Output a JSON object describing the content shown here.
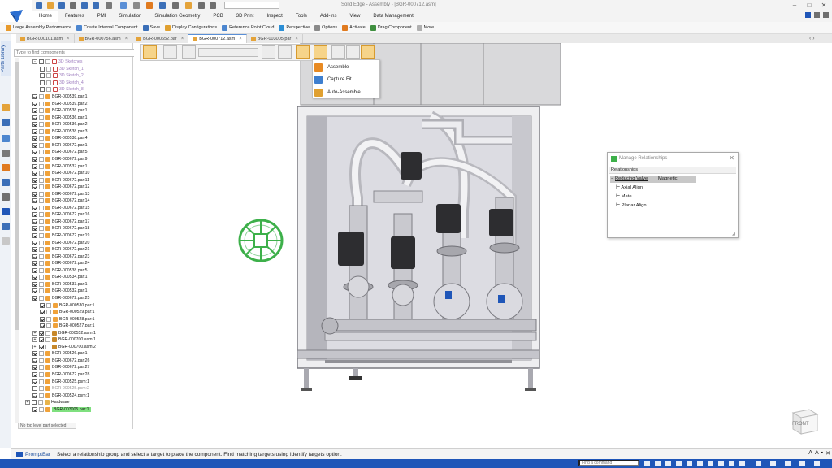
{
  "window": {
    "title": "Solid Edge - Assembly - [BGR-000712.asm]"
  },
  "ribbon_tabs": [
    "Home",
    "Features",
    "PMI",
    "Simulation",
    "Simulation Geometry",
    "PCB",
    "3D Print",
    "Inspect",
    "Tools",
    "Add-Ins",
    "View",
    "Data Management"
  ],
  "command_bar": [
    {
      "label": "Large Assembly Performance",
      "color": "#e89a2c"
    },
    {
      "label": "Create Internal Component",
      "color": "#4c86cf"
    },
    {
      "label": "Save",
      "color": "#3b6fb8"
    },
    {
      "label": "Display Configurations",
      "color": "#e0a030"
    },
    {
      "label": "Reference Point Cloud",
      "color": "#4c86cf"
    },
    {
      "label": "Perspective",
      "color": "#2c8fd6"
    },
    {
      "label": "Options",
      "color": "#8a8a8a"
    },
    {
      "label": "Activate",
      "color": "#e07a1f"
    },
    {
      "label": "Drag Component",
      "color": "#3f8f3f"
    },
    {
      "label": "More",
      "color": "#b0b0b0"
    }
  ],
  "doc_tabs": [
    {
      "label": "BGR-000101.asm",
      "active": false
    },
    {
      "label": "BGR-000756.asm",
      "active": false
    },
    {
      "label": "BGR-000652.par",
      "active": false
    },
    {
      "label": "BGR-000712.asm",
      "active": true
    },
    {
      "label": "BGR-003005.par",
      "active": false
    }
  ],
  "sidebar": {
    "parts_library": "Parts Library"
  },
  "pathfinder": {
    "search_placeholder": "Type to find components",
    "status": "No top level part selected",
    "items": [
      {
        "label": "3D Sketches",
        "type": "sketch",
        "indent": 1,
        "checked": false,
        "expand": "-"
      },
      {
        "label": "3D Sketch_1",
        "type": "sketch",
        "indent": 2,
        "checked": false
      },
      {
        "label": "3D Sketch_2",
        "type": "sketch",
        "indent": 2,
        "checked": false
      },
      {
        "label": "3D Sketch_4",
        "type": "sketch",
        "indent": 2,
        "checked": false
      },
      {
        "label": "3D Sketch_8",
        "type": "sketch",
        "indent": 2,
        "checked": false
      },
      {
        "label": "BGR-000539.par:1",
        "type": "part",
        "indent": 1,
        "checked": true
      },
      {
        "label": "BGR-000539.par:2",
        "type": "part",
        "indent": 1,
        "checked": true
      },
      {
        "label": "BGR-000538.par:1",
        "type": "part",
        "indent": 1,
        "checked": true
      },
      {
        "label": "BGR-000536.par:1",
        "type": "part",
        "indent": 1,
        "checked": true
      },
      {
        "label": "BGR-000536.par:2",
        "type": "part",
        "indent": 1,
        "checked": true
      },
      {
        "label": "BGR-000538.par:3",
        "type": "part",
        "indent": 1,
        "checked": true
      },
      {
        "label": "BGR-000538.par:4",
        "type": "part",
        "indent": 1,
        "checked": true
      },
      {
        "label": "BGR-000672.par:1",
        "type": "part",
        "indent": 1,
        "checked": true
      },
      {
        "label": "BGR-000672.par:5",
        "type": "part",
        "indent": 1,
        "checked": true
      },
      {
        "label": "BGR-000672.par:9",
        "type": "part",
        "indent": 1,
        "checked": true
      },
      {
        "label": "BGR-000537.par:1",
        "type": "part",
        "indent": 1,
        "checked": true
      },
      {
        "label": "BGR-000672.par:10",
        "type": "part",
        "indent": 1,
        "checked": true
      },
      {
        "label": "BGR-000672.par:11",
        "type": "part",
        "indent": 1,
        "checked": true
      },
      {
        "label": "BGR-000672.par:12",
        "type": "part",
        "indent": 1,
        "checked": true
      },
      {
        "label": "BGR-000672.par:13",
        "type": "part",
        "indent": 1,
        "checked": true
      },
      {
        "label": "BGR-000672.par:14",
        "type": "part",
        "indent": 1,
        "checked": true
      },
      {
        "label": "BGR-000672.par:15",
        "type": "part",
        "indent": 1,
        "checked": true
      },
      {
        "label": "BGR-000672.par:16",
        "type": "part",
        "indent": 1,
        "checked": true
      },
      {
        "label": "BGR-000672.par:17",
        "type": "part",
        "indent": 1,
        "checked": true
      },
      {
        "label": "BGR-000672.par:18",
        "type": "part",
        "indent": 1,
        "checked": true
      },
      {
        "label": "BGR-000672.par:19",
        "type": "part",
        "indent": 1,
        "checked": true
      },
      {
        "label": "BGR-000672.par:20",
        "type": "part",
        "indent": 1,
        "checked": true
      },
      {
        "label": "BGR-000672.par:21",
        "type": "part",
        "indent": 1,
        "checked": true
      },
      {
        "label": "BGR-000672.par:23",
        "type": "part",
        "indent": 1,
        "checked": true
      },
      {
        "label": "BGR-000672.par:24",
        "type": "part",
        "indent": 1,
        "checked": true
      },
      {
        "label": "BGR-000538.par:5",
        "type": "part",
        "indent": 1,
        "checked": true
      },
      {
        "label": "BGR-000534.par:1",
        "type": "part",
        "indent": 1,
        "checked": true
      },
      {
        "label": "BGR-000533.par:1",
        "type": "part",
        "indent": 1,
        "checked": true
      },
      {
        "label": "BGR-000532.par:1",
        "type": "part",
        "indent": 1,
        "checked": true
      },
      {
        "label": "BGR-000672.par:25",
        "type": "part",
        "indent": 1,
        "checked": true
      },
      {
        "label": "BGR-000530.par:1",
        "type": "part",
        "indent": 2,
        "checked": true
      },
      {
        "label": "BGR-000529.par:1",
        "type": "part",
        "indent": 2,
        "checked": true
      },
      {
        "label": "BGR-000528.par:1",
        "type": "part",
        "indent": 2,
        "checked": true
      },
      {
        "label": "BGR-000527.par:1",
        "type": "part",
        "indent": 2,
        "checked": true
      },
      {
        "label": "BGR-000552.asm:1",
        "type": "asm",
        "indent": 1,
        "checked": true,
        "expand": "+"
      },
      {
        "label": "BGR-000700.asm:1",
        "type": "asm",
        "indent": 1,
        "checked": true,
        "expand": "+"
      },
      {
        "label": "BGR-000700.asm:2",
        "type": "asm",
        "indent": 1,
        "checked": true,
        "expand": "+"
      },
      {
        "label": "BGR-000526.par:1",
        "type": "part",
        "indent": 1,
        "checked": true
      },
      {
        "label": "BGR-000672.par:26",
        "type": "part",
        "indent": 1,
        "checked": true
      },
      {
        "label": "BGR-000672.par:27",
        "type": "part",
        "indent": 1,
        "checked": true
      },
      {
        "label": "BGR-000672.par:28",
        "type": "part",
        "indent": 1,
        "checked": true
      },
      {
        "label": "BGR-000525.psm:1",
        "type": "part",
        "indent": 1,
        "checked": true
      },
      {
        "label": "BGR-000525.psm:2",
        "type": "grey",
        "indent": 1,
        "checked": false
      },
      {
        "label": "BGR-000524.psm:1",
        "type": "part",
        "indent": 1,
        "checked": true
      },
      {
        "label": "Hardware",
        "type": "hw",
        "indent": 0,
        "checked": false,
        "expand": "+"
      },
      {
        "label": "BGR-003005.par:1",
        "type": "highlight",
        "indent": 1,
        "checked": true
      }
    ]
  },
  "assemble_menu": {
    "items": [
      {
        "label": "Assemble",
        "color": "#e88a22"
      },
      {
        "label": "Capture Fit",
        "color": "#3e7fcf"
      },
      {
        "label": "Auto-Assemble",
        "color": "#e0a030"
      }
    ]
  },
  "relationships": {
    "title": "Manage Relationships",
    "header": "Relationships",
    "group": "Reducing Valve",
    "group_value": "Magnetic",
    "children": [
      "Axial Align",
      "Mate",
      "Planar Align"
    ]
  },
  "viewcube": {
    "label": "FRONT"
  },
  "prompt": {
    "label": "PromptBar",
    "text": "Select a relationship group and select a target to place the component. Find matching targets using Identify targets option."
  },
  "status": {
    "find_placeholder": "Find a command"
  },
  "colors": {
    "accent": "#1f56b8",
    "highlight": "#7fe07f",
    "handwheel": "#3db04a"
  }
}
